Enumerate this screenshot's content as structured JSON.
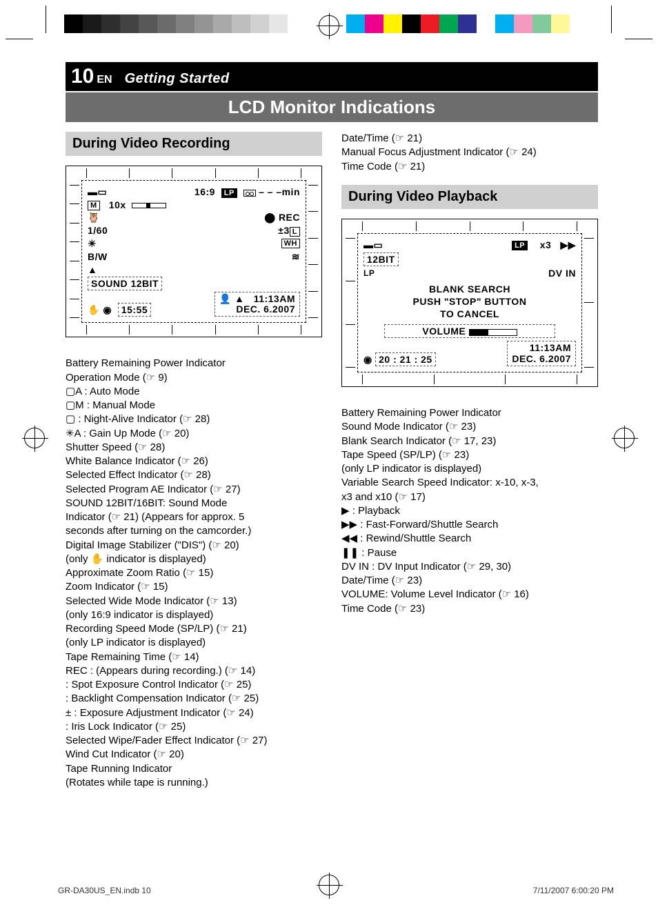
{
  "header": {
    "page_num": "10",
    "lang": "EN",
    "section": "Getting Started"
  },
  "title": "LCD Monitor Indications",
  "recording": {
    "subhead": "During Video Recording",
    "lcd": {
      "top_line": {
        "ratio": "16:9",
        "lp": "LP",
        "min": "– – –min"
      },
      "mode_box": "M",
      "zoom": "10x",
      "rec": "REC",
      "shutter_row": {
        "left": "1/60",
        "right": "±3"
      },
      "wb_right": "WH",
      "bw": "B/W",
      "sound": "SOUND   12BIT",
      "time": "15:55",
      "datetime_top": "11:13AM",
      "datetime_bot": "DEC.   6.2007"
    },
    "items": [
      "Battery Remaining Power Indicator",
      "Operation Mode (☞ 9)",
      "▢A : Auto Mode",
      "▢M : Manual Mode",
      "▢ : Night-Alive Indicator (☞ 28)",
      "✳A : Gain Up Mode (☞ 20)",
      "Shutter Speed (☞ 28)",
      "White Balance Indicator (☞ 26)",
      "Selected Effect Indicator (☞ 28)",
      "Selected Program AE Indicator (☞ 27)",
      "SOUND 12BIT/16BIT: Sound Mode",
      "Indicator (☞ 21) (Appears for approx. 5",
      "seconds after turning on the camcorder.)",
      "Digital Image Stabilizer (\"DIS\") (☞ 20)",
      "(only ✋ indicator is displayed)",
      "Approximate Zoom Ratio (☞ 15)",
      "Zoom Indicator (☞ 15)",
      "Selected Wide Mode Indicator (☞ 13)",
      "(only 16:9 indicator is displayed)",
      "Recording Speed Mode (SP/LP) (☞ 21)",
      "(only LP indicator is displayed)",
      "Tape Remaining Time (☞ 14)",
      "REC : (Appears during recording.) (☞ 14)",
      "       : Spot Exposure Control Indicator (☞ 25)",
      "       : Backlight Compensation Indicator (☞ 25)",
      "± : Exposure Adjustment Indicator (☞ 24)",
      "     : Iris Lock Indicator (☞ 25)",
      "Selected Wipe/Fader Effect Indicator (☞ 27)",
      "Wind Cut Indicator (☞ 20)",
      "Tape Running Indicator",
      "(Rotates while tape is running.)"
    ]
  },
  "playback_top_items": [
    "Date/Time (☞ 21)",
    "Manual Focus Adjustment Indicator (☞ 24)",
    "Time Code (☞ 21)"
  ],
  "playback": {
    "subhead": "During Video Playback",
    "lcd": {
      "lp": "LP",
      "speed": "x3",
      "play": "▶▶",
      "bit": "12BIT",
      "lp_small": "LP",
      "dvin": "DV IN",
      "blank1": "BLANK  SEARCH",
      "blank2": "PUSH \"STOP\" BUTTON",
      "blank3": "TO  CANCEL",
      "volume_label": "VOLUME",
      "tc": "20 : 21 : 25",
      "datetime_top": "11:13AM",
      "datetime_bot": "DEC.   6.2007"
    },
    "items": [
      "Battery Remaining Power Indicator",
      "Sound Mode Indicator (☞ 23)",
      "Blank Search Indicator (☞ 17, 23)",
      "Tape Speed (SP/LP) (☞ 23)",
      "(only LP indicator is displayed)",
      "Variable Search Speed Indicator: x-10, x-3,",
      "x3 and x10 (☞ 17)",
      "▶ : Playback",
      "▶▶ : Fast-Forward/Shuttle Search",
      "◀◀ : Rewind/Shuttle Search",
      "❚❚ : Pause",
      "DV IN : DV Input Indicator (☞ 29, 30)",
      "Date/Time (☞ 23)",
      "VOLUME: Volume Level Indicator (☞ 16)",
      "Time Code (☞ 23)"
    ]
  },
  "footer": {
    "left": "GR-DA30US_EN.indb   10",
    "right": "7/11/2007   6:00:20 PM"
  },
  "colorbar_left": [
    "#000",
    "#1a1a1a",
    "#2e2e2e",
    "#424242",
    "#575757",
    "#6b6b6b",
    "#808080",
    "#949494",
    "#a9a9a9",
    "#bdbdbd",
    "#d1d1d1",
    "#e6e6e6",
    "#fff"
  ],
  "colorbar_right": [
    "#00aeef",
    "#ec008c",
    "#fff200",
    "#000",
    "#ed1c24",
    "#00a651",
    "#2e3192",
    "#fff",
    "#00aeef",
    "#f49ac1",
    "#82ca9c",
    "#fff799"
  ]
}
